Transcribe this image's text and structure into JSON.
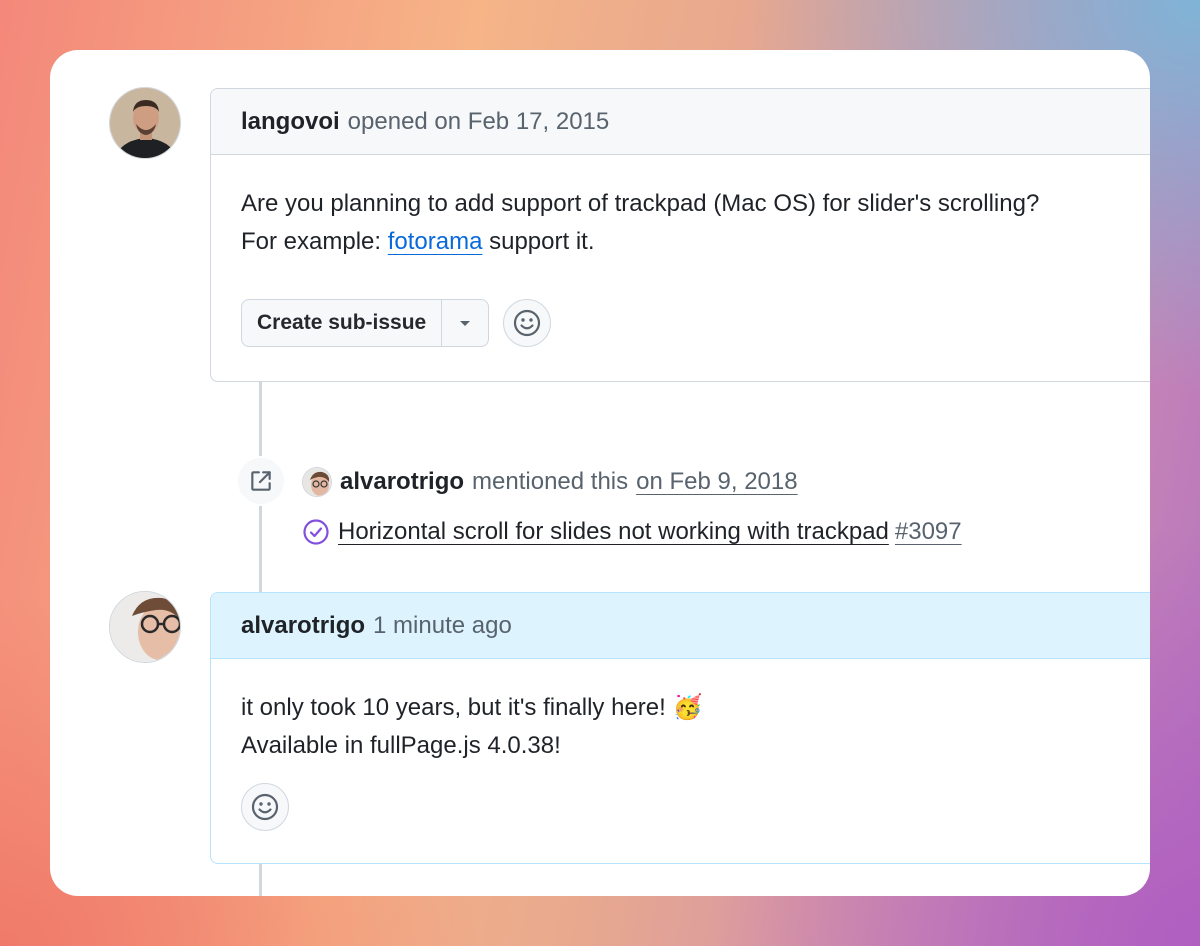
{
  "comment1": {
    "author": "langovoi",
    "meta": "opened on Feb 17, 2015",
    "body_line1": "Are you planning to add support of trackpad (Mac OS) for slider's scrolling?",
    "body_line2_prefix": "For example: ",
    "body_link": "fotorama",
    "body_line2_suffix": " support it.",
    "create_subissue_label": "Create sub-issue"
  },
  "mention": {
    "author": "alvarotrigo",
    "action": "mentioned this",
    "date": "on Feb 9, 2018",
    "ref_title": "Horizontal scroll for slides not working with trackpad",
    "ref_number": "#3097"
  },
  "comment2": {
    "author": "alvarotrigo",
    "meta": "1 minute ago",
    "body_line1": "it only took 10 years, but it's finally here! 🥳",
    "body_line2": "Available in fullPage.js 4.0.38!"
  },
  "colors": {
    "link": "#0969da",
    "muted": "#59636e",
    "text": "#1f2328",
    "border": "#d0d7de",
    "highlight_bg": "#ddf4ff",
    "closed_purple": "#8250df"
  }
}
